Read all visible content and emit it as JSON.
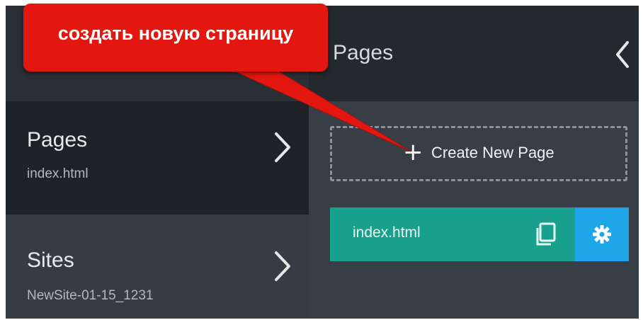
{
  "sidebar": {
    "pages": {
      "title": "Pages",
      "subtitle": "index.html"
    },
    "sites": {
      "title": "Sites",
      "subtitle": "NewSite-01-15_1231"
    }
  },
  "panel": {
    "title": "Pages",
    "create_new_label": "Create New Page",
    "page_item": {
      "label": "index.html"
    }
  },
  "callout": {
    "text": "создать новую страницу"
  },
  "colors": {
    "callout": "#e3170f",
    "page_row": "#17a08b",
    "gear_button": "#1ea7e8",
    "sidebar_dark": "#1f2328",
    "panel": "#373e45"
  },
  "icons": {
    "back": "chevron-left-icon",
    "sidebar_chevron": "chevron-right-icon",
    "create": "plus-icon",
    "duplicate": "copy-icon",
    "settings": "gear-icon"
  }
}
